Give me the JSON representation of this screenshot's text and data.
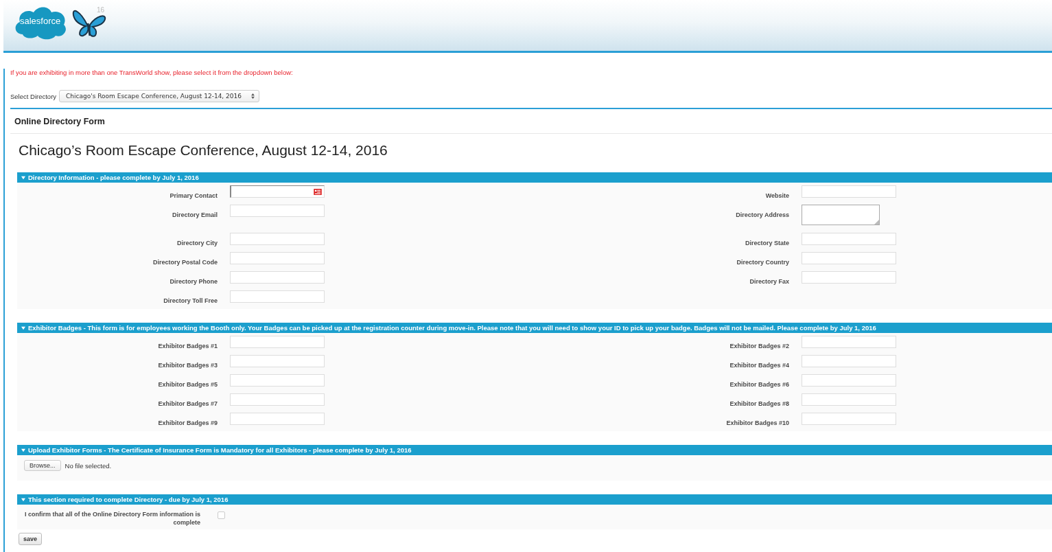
{
  "header": {
    "logo_text": "salesforce",
    "badge_text": "16"
  },
  "notice": "If you are exhibiting in more than one TransWorld show, please select it from the dropdown below:",
  "directory_select": {
    "label": "Select Directory",
    "value": "Chicago's Room Escape Conference, August 12-14, 2016"
  },
  "form_title": "Online Directory Form",
  "event_title": "Chicago’s Room Escape Conference, August 12-14, 2016",
  "sections": [
    {
      "kind": "fields",
      "title": "Directory Information - please complete by July 1, 2016",
      "expanded": true,
      "rows": [
        {
          "left": {
            "label": "Primary Contact",
            "kind": "lookup"
          },
          "right": {
            "label": "Website",
            "kind": "text"
          }
        },
        {
          "left": {
            "label": "Directory Email",
            "kind": "text"
          },
          "right": {
            "label": "Directory Address",
            "kind": "textarea"
          }
        },
        {
          "left": {
            "label": "Directory City",
            "kind": "text"
          },
          "right": {
            "label": "Directory State",
            "kind": "text"
          }
        },
        {
          "left": {
            "label": "Directory Postal Code",
            "kind": "text"
          },
          "right": {
            "label": "Directory Country",
            "kind": "text"
          }
        },
        {
          "left": {
            "label": "Directory Phone",
            "kind": "text"
          },
          "right": {
            "label": "Directory Fax",
            "kind": "text"
          }
        },
        {
          "left": {
            "label": "Directory Toll Free",
            "kind": "text"
          }
        }
      ]
    },
    {
      "kind": "fields",
      "title": "Exhibitor Badges - This form is for employees working the Booth only. Your Badges can be picked up at the registration counter during move-in. Please note that you will need to show your ID to pick up your badge. Badges will not be mailed. Please complete by July 1, 2016",
      "expanded": true,
      "rows": [
        {
          "left": {
            "label": "Exhibitor Badges #1",
            "kind": "text"
          },
          "right": {
            "label": "Exhibitor Badges #2",
            "kind": "text"
          }
        },
        {
          "left": {
            "label": "Exhibitor Badges #3",
            "kind": "text"
          },
          "right": {
            "label": "Exhibitor Badges #4",
            "kind": "text"
          }
        },
        {
          "left": {
            "label": "Exhibitor Badges #5",
            "kind": "text"
          },
          "right": {
            "label": "Exhibitor Badges #6",
            "kind": "text"
          }
        },
        {
          "left": {
            "label": "Exhibitor Badges #7",
            "kind": "text"
          },
          "right": {
            "label": "Exhibitor Badges #8",
            "kind": "text"
          }
        },
        {
          "left": {
            "label": "Exhibitor Badges #9",
            "kind": "text"
          },
          "right": {
            "label": "Exhibitor Badges #10",
            "kind": "text"
          }
        }
      ]
    },
    {
      "kind": "upload",
      "title": "Upload Exhibitor Forms - The Certificate of Insurance Form is Mandatory for all Exhibitors - please complete by July 1, 2016",
      "expanded": true,
      "button": "Browse...",
      "status": "No file selected."
    },
    {
      "kind": "confirm",
      "title": "This section required to complete Directory - due by July 1, 2016",
      "expanded": true,
      "label": "I confirm that all of the Online Directory Form information is complete",
      "checked": false
    }
  ],
  "save_button": "save"
}
